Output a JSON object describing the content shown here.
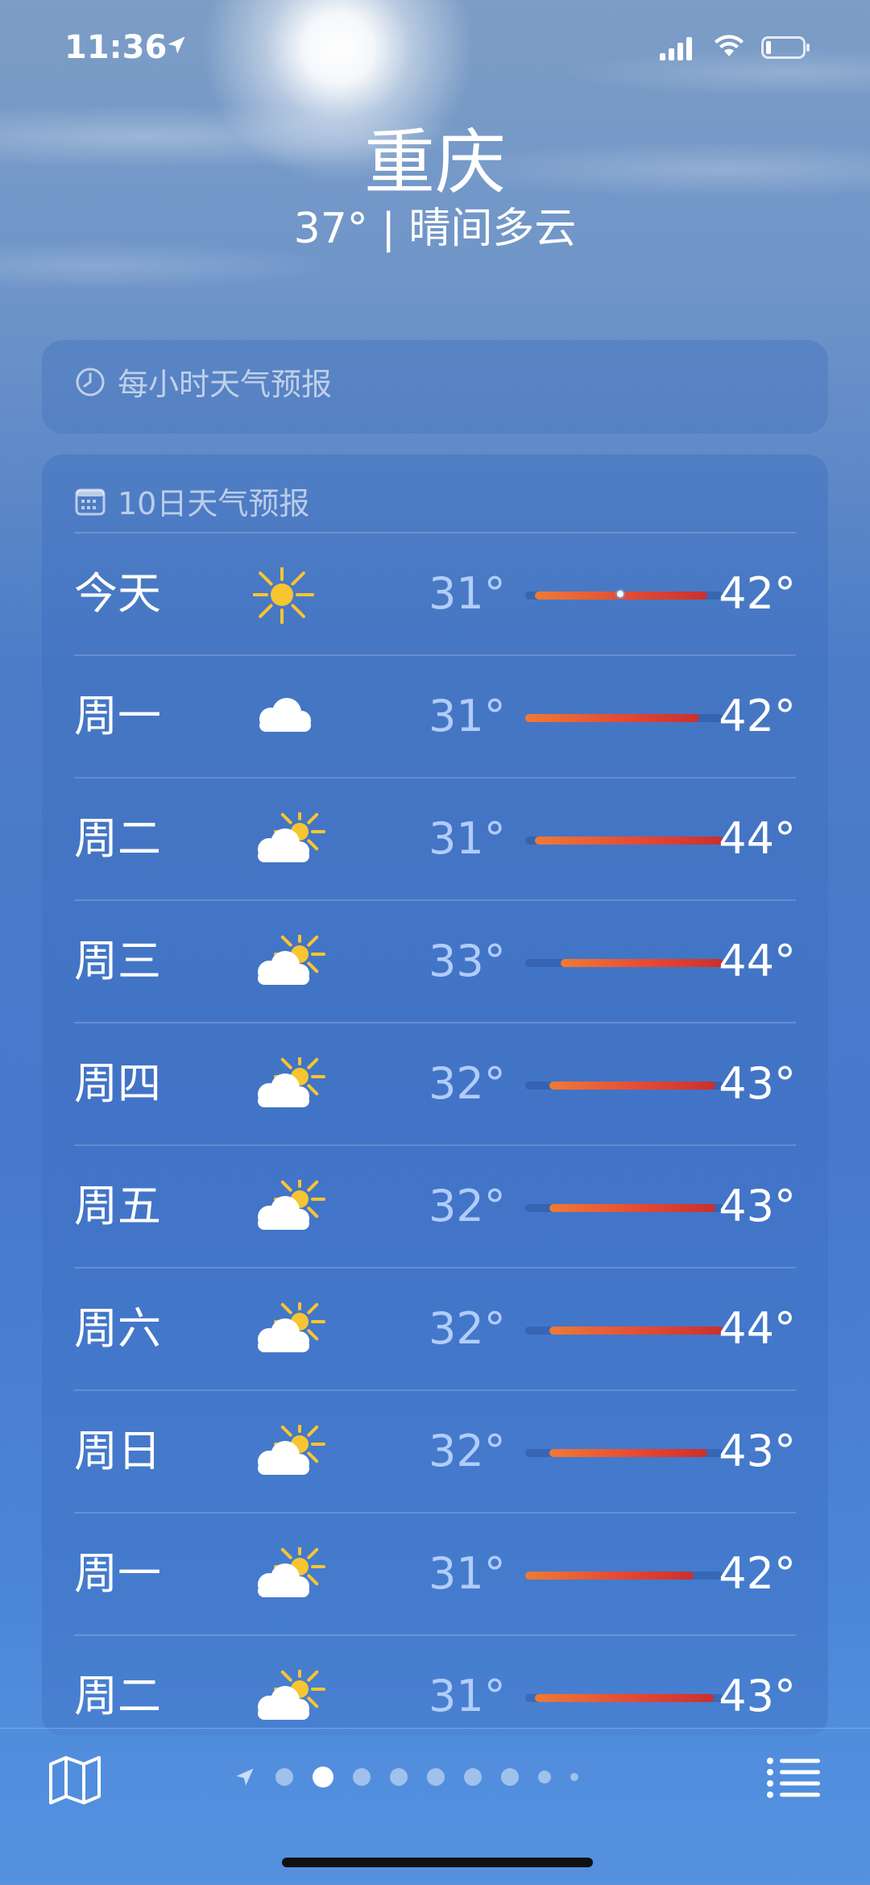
{
  "status_bar": {
    "time": "11:36",
    "icons": [
      "location-arrow-icon",
      "cellular-signal-icon",
      "wifi-icon",
      "battery-icon"
    ]
  },
  "header": {
    "city": "重庆",
    "summary": "37° | 晴间多云"
  },
  "hourly_card": {
    "title": "每小时天气预报",
    "icon": "clock-icon"
  },
  "daily_card": {
    "title": "10日天气预报",
    "icon": "calendar-icon",
    "days": [
      {
        "day": "今天",
        "icon": "sun-icon",
        "low": "31°",
        "high": "42°",
        "range": [
          0.05,
          0.92
        ],
        "current": 0.48
      },
      {
        "day": "周一",
        "icon": "cloud-icon",
        "low": "31°",
        "high": "42°",
        "range": [
          0.0,
          0.88
        ]
      },
      {
        "day": "周二",
        "icon": "partly-cloudy-icon",
        "low": "31°",
        "high": "44°",
        "range": [
          0.05,
          1.0
        ]
      },
      {
        "day": "周三",
        "icon": "partly-cloudy-icon",
        "low": "33°",
        "high": "44°",
        "range": [
          0.18,
          1.0
        ]
      },
      {
        "day": "周四",
        "icon": "partly-cloudy-icon",
        "low": "32°",
        "high": "43°",
        "range": [
          0.12,
          0.96
        ]
      },
      {
        "day": "周五",
        "icon": "partly-cloudy-icon",
        "low": "32°",
        "high": "43°",
        "range": [
          0.12,
          0.96
        ]
      },
      {
        "day": "周六",
        "icon": "partly-cloudy-icon",
        "low": "32°",
        "high": "44°",
        "range": [
          0.12,
          1.0
        ]
      },
      {
        "day": "周日",
        "icon": "partly-cloudy-icon",
        "low": "32°",
        "high": "43°",
        "range": [
          0.12,
          0.92
        ]
      },
      {
        "day": "周一",
        "icon": "partly-cloudy-icon",
        "low": "31°",
        "high": "42°",
        "range": [
          0.0,
          0.85
        ]
      },
      {
        "day": "周二",
        "icon": "partly-cloudy-icon",
        "low": "31°",
        "high": "43°",
        "range": [
          0.05,
          0.95
        ]
      }
    ]
  },
  "bottom_bar": {
    "map_icon": "map-icon",
    "list_icon": "list-icon",
    "pages": [
      "location",
      "page",
      "active",
      "page",
      "page",
      "page",
      "page",
      "page",
      "small",
      "tiny"
    ]
  },
  "colors": {
    "accent_warm": "#e44a35",
    "accent_orange": "#ef7a36"
  }
}
